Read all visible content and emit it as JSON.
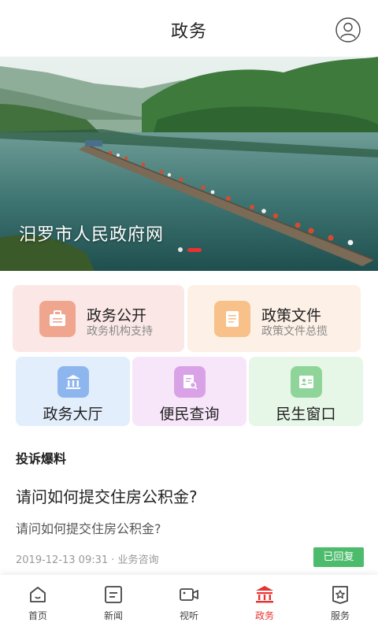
{
  "header": {
    "title": "政务",
    "avatar_icon": "user-circle-icon"
  },
  "banner": {
    "caption": "汨罗市人民政府网",
    "slides_total": 2,
    "active_slide": 2
  },
  "services_top": [
    {
      "title": "政务公开",
      "subtitle": "政务机构支持",
      "icon": "briefcase-icon",
      "bg": "#fbe8e6",
      "icon_bg": "#f0a58f"
    },
    {
      "title": "政策文件",
      "subtitle": "政策文件总揽",
      "icon": "document-icon",
      "bg": "#fdf0e6",
      "icon_bg": "#f7c189"
    }
  ],
  "services_bottom": [
    {
      "title": "政务大厅",
      "icon": "building-icon",
      "bg": "#e3eefc",
      "icon_bg": "#8eb6ee"
    },
    {
      "title": "便民查询",
      "icon": "search-document-icon",
      "bg": "#f7e6fa",
      "icon_bg": "#d9a2e7"
    },
    {
      "title": "民生窗口",
      "icon": "id-card-icon",
      "bg": "#e6f6e7",
      "icon_bg": "#8fd59a"
    }
  ],
  "complaints": {
    "section_title": "投诉爆料",
    "item": {
      "title": "请问如何提交住房公积金?",
      "summary": "请问如何提交住房公积金?",
      "datetime": "2019-12-13 09:31",
      "category": "业务咨询",
      "meta": "2019-12-13 09:31 · 业务咨询",
      "status": "已回复",
      "status_color": "#4cbb6b"
    }
  },
  "tabbar": {
    "active_color": "#e7322f",
    "items": [
      {
        "label": "首页",
        "icon": "home-icon",
        "active": false
      },
      {
        "label": "新闻",
        "icon": "news-icon",
        "active": false
      },
      {
        "label": "视听",
        "icon": "video-camera-icon",
        "active": false
      },
      {
        "label": "政务",
        "icon": "government-building-icon",
        "active": true
      },
      {
        "label": "服务",
        "icon": "service-star-icon",
        "active": false
      }
    ]
  }
}
